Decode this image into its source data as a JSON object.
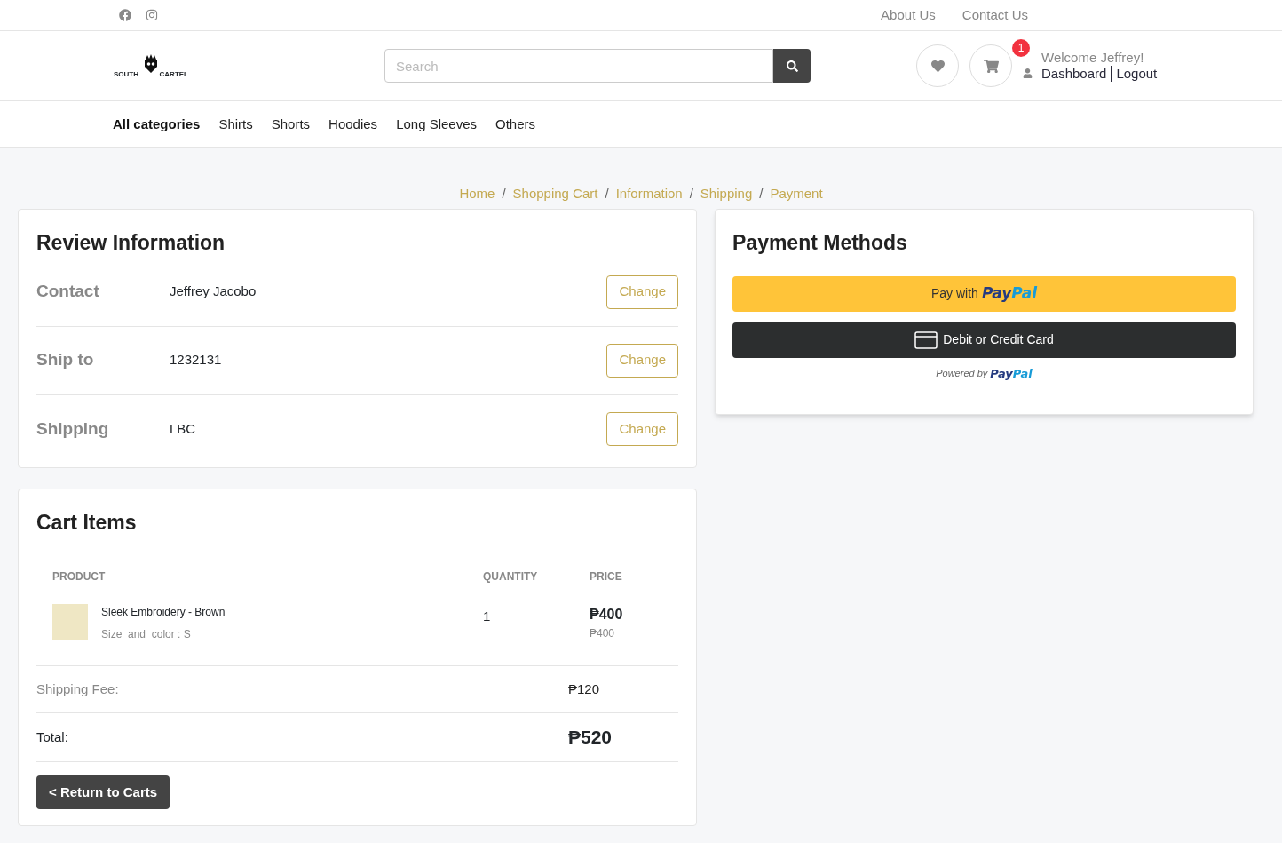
{
  "top_links": [
    "About Us",
    "Contact Us"
  ],
  "logo": {
    "left": "SOUTH",
    "right": "CARTEL"
  },
  "search": {
    "placeholder": "Search"
  },
  "cart_badge": "1",
  "user": {
    "welcome": "Welcome Jeffrey!",
    "dashboard": "Dashboard",
    "logout": "Logout"
  },
  "nav": [
    {
      "label": "All categories",
      "selected": true
    },
    {
      "label": "Shirts",
      "selected": false
    },
    {
      "label": "Shorts",
      "selected": false
    },
    {
      "label": "Hoodies",
      "selected": false
    },
    {
      "label": "Long Sleeves",
      "selected": false
    },
    {
      "label": "Others",
      "selected": false
    }
  ],
  "breadcrumb": [
    {
      "label": "Home"
    },
    {
      "separator": "/",
      "label": "Shopping Cart"
    },
    {
      "separator": "/",
      "label": "Information"
    },
    {
      "separator": "/",
      "label": "Shipping"
    },
    {
      "separator": "/",
      "label": "Payment"
    }
  ],
  "review": {
    "title": "Review Information",
    "rows": [
      {
        "label": "Contact",
        "value": "Jeffrey Jacobo",
        "button": "Change"
      },
      {
        "label": "Ship to",
        "value": "1232131",
        "button": "Change"
      },
      {
        "label": "Shipping",
        "value": "LBC",
        "button": "Change"
      }
    ]
  },
  "cart": {
    "title": "Cart Items",
    "columns": [
      "PRODUCT",
      "QUANTITY",
      "PRICE"
    ],
    "items": [
      {
        "name": "Sleek Embroidery - Brown",
        "variant": "Size_and_color : S",
        "quantity": "1",
        "price": "₱400",
        "unit_price": "₱400"
      }
    ],
    "shipping_label": "Shipping Fee:",
    "shipping_value": "₱120",
    "total_label": "Total:",
    "total_value": "₱520",
    "return_button": "< Return to Carts"
  },
  "payment": {
    "title": "Payment Methods",
    "paypal_prefix": "Pay with",
    "brand_a": "Pay",
    "brand_b": "Pal",
    "card_button": "Debit or Credit Card",
    "powered_by": "Powered by",
    "powered_brand_a": "Pay",
    "powered_brand_b": "Pal"
  }
}
